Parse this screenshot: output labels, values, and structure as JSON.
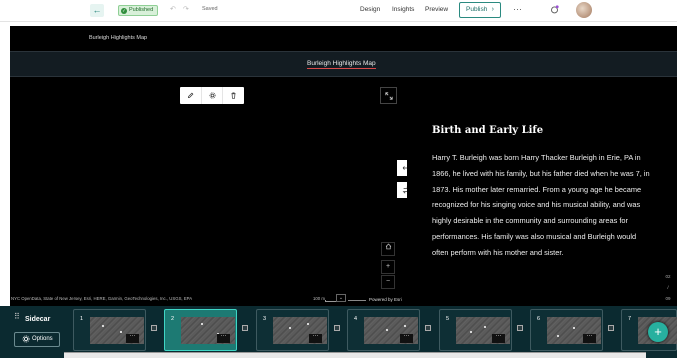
{
  "topbar": {
    "back_icon": "arrow-left-icon",
    "status": "Published",
    "saved": "Saved",
    "nav": [
      "Design",
      "Insights",
      "Preview"
    ],
    "publish_label": "Publish",
    "more_label": "···"
  },
  "frame": {
    "header_title": "Burleigh Highlights Map",
    "title": "Burleigh Highlights Map"
  },
  "map": {
    "attribution": "NYC OpenData, State of New Jersey, Esri, HERE, Garmin, GeoTechnologies, Inc., USGS, EPA",
    "scale": "100 m",
    "powered_by": "Powered by Esri",
    "zoom_in": "+",
    "zoom_out": "−"
  },
  "narrative": {
    "heading": "Birth and Early Life",
    "body": "Harry T. Burleigh was born Harry Thacker Burleigh in Erie, PA in 1866, he lived with his family, but his father died when he was 7, in 1873. His mother later remarried. From a young age he became recognized for his singing voice and his musical ability, and was highly desirable in the community and surrounding areas for performances. His family was also musical and Burleigh would often perform with his mother and sister."
  },
  "progress": {
    "current": "02",
    "sep": "/",
    "total": "09"
  },
  "carousel": {
    "label": "Sidecar",
    "options_label": "Options",
    "slides": [
      {
        "num": "1",
        "menu": "···"
      },
      {
        "num": "2",
        "menu": "···",
        "active": true
      },
      {
        "num": "3",
        "menu": "···"
      },
      {
        "num": "4",
        "menu": "···"
      },
      {
        "num": "5",
        "menu": "···"
      },
      {
        "num": "6",
        "menu": "···"
      },
      {
        "num": "7",
        "menu": "···"
      }
    ],
    "add_label": "+"
  },
  "colors": {
    "accent": "#1d7a73",
    "active_border": "#3fd6c5",
    "carousel_bg": "#0b2a30",
    "published_bg": "#d8f0d9"
  }
}
